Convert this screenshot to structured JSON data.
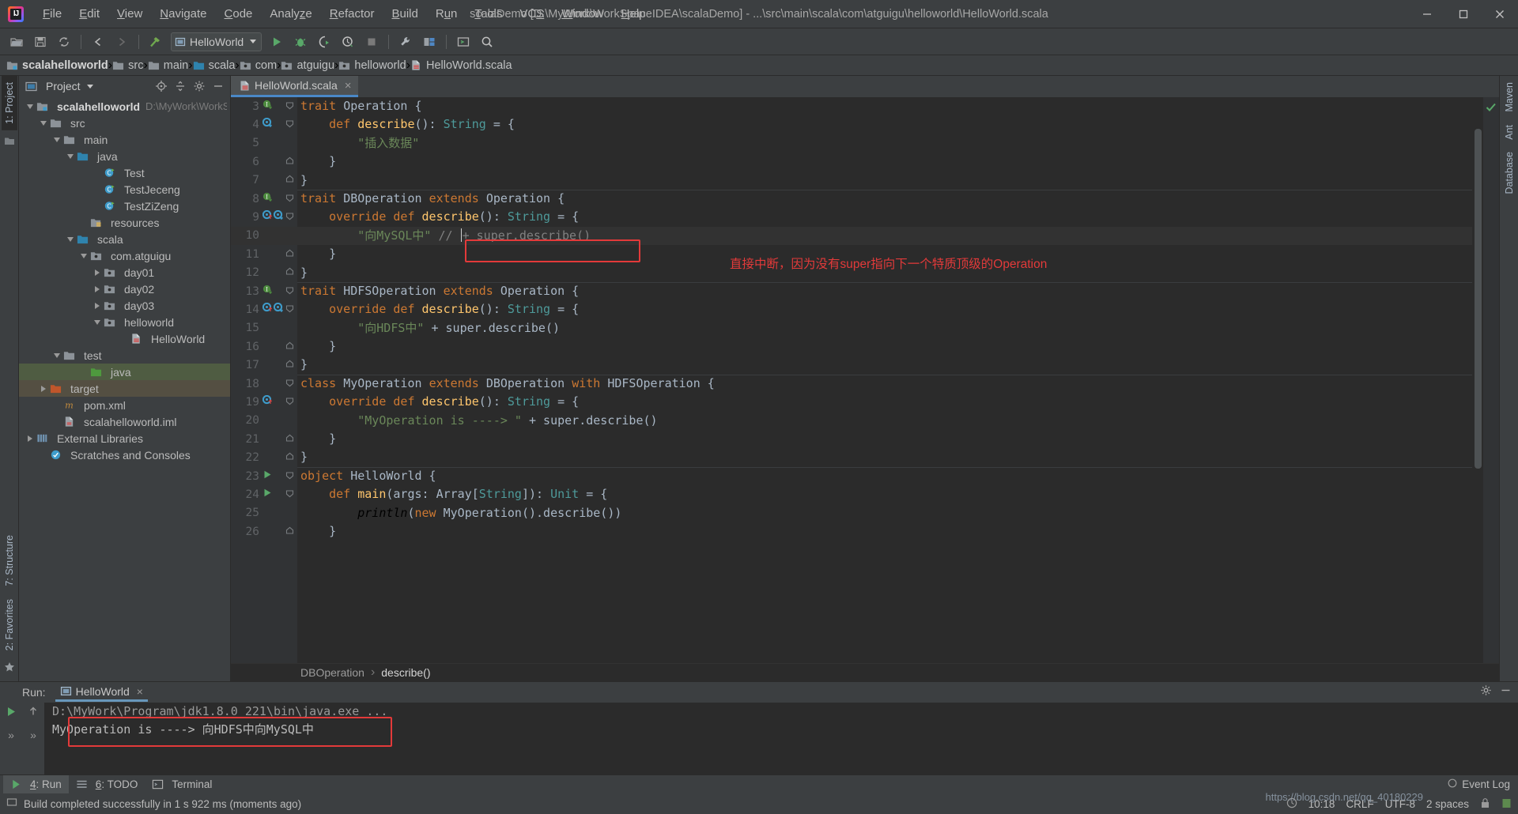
{
  "window": {
    "title": "scalaDemo [D:\\MyWork\\WorkSpaceIDEA\\scalaDemo] - ...\\src\\main\\scala\\com\\atguigu\\helloworld\\HelloWorld.scala",
    "minimize_label": "minimize-window",
    "maximize_label": "maximize-window",
    "close_label": "close-window"
  },
  "menubar": {
    "items": [
      {
        "label": "File",
        "mnemonic": "F"
      },
      {
        "label": "Edit",
        "mnemonic": "E"
      },
      {
        "label": "View",
        "mnemonic": "V"
      },
      {
        "label": "Navigate",
        "mnemonic": "N"
      },
      {
        "label": "Code",
        "mnemonic": "C"
      },
      {
        "label": "Analyze",
        "mnemonic": "z"
      },
      {
        "label": "Refactor",
        "mnemonic": "R"
      },
      {
        "label": "Build",
        "mnemonic": "B"
      },
      {
        "label": "Run",
        "mnemonic": "u"
      },
      {
        "label": "Tools",
        "mnemonic": "T"
      },
      {
        "label": "VCS",
        "mnemonic": "S"
      },
      {
        "label": "Window",
        "mnemonic": "W"
      },
      {
        "label": "Help",
        "mnemonic": "H"
      }
    ]
  },
  "toolbar": {
    "run_config": "HelloWorld",
    "buttons": [
      "open-folder-icon",
      "save-all-icon",
      "sync-icon",
      "back-arrow-icon",
      "forward-arrow-icon",
      "build-hammer-icon",
      "run-icon",
      "debug-icon",
      "run-with-coverage-icon",
      "profile-icon",
      "stop-icon",
      "settings-wrench-icon",
      "project-structure-icon",
      "terminal-icon",
      "search-everywhere-icon"
    ]
  },
  "breadcrumb": {
    "items": [
      {
        "label": "scalahelloworld",
        "icon": "module-folder-icon"
      },
      {
        "label": "src",
        "icon": "folder-icon"
      },
      {
        "label": "main",
        "icon": "folder-icon"
      },
      {
        "label": "scala",
        "icon": "source-folder-icon"
      },
      {
        "label": "com",
        "icon": "package-icon"
      },
      {
        "label": "atguigu",
        "icon": "package-icon"
      },
      {
        "label": "helloworld",
        "icon": "package-icon"
      },
      {
        "label": "HelloWorld.scala",
        "icon": "scala-file-icon"
      }
    ]
  },
  "left_rail": {
    "tabs": [
      {
        "label": "1: Project",
        "active": true
      }
    ],
    "bottom_tabs": [
      {
        "label": "7: Structure"
      },
      {
        "label": "2: Favorites"
      }
    ]
  },
  "right_rail": {
    "tabs": [
      {
        "label": "Maven"
      },
      {
        "label": "Ant"
      },
      {
        "label": "Database"
      }
    ]
  },
  "project_panel": {
    "title": "Project",
    "locate_icon": "locate-target-icon",
    "collapse_icon": "collapse-all-icon",
    "settings_icon": "gear-icon",
    "hide_icon": "hide-panel-icon",
    "tree": [
      {
        "label": "scalahelloworld",
        "path": "D:\\MyWork\\WorkSpac",
        "indent": 0,
        "twisty": "down",
        "icon": "module-folder-icon",
        "bold": true
      },
      {
        "label": "src",
        "indent": 1,
        "twisty": "down",
        "icon": "folder-icon"
      },
      {
        "label": "main",
        "indent": 2,
        "twisty": "down",
        "icon": "folder-icon"
      },
      {
        "label": "java",
        "indent": 3,
        "twisty": "down",
        "icon": "source-folder-icon"
      },
      {
        "label": "Test",
        "indent": 5,
        "twisty": "none",
        "icon": "scala-class-icon"
      },
      {
        "label": "TestJeceng",
        "indent": 5,
        "twisty": "none",
        "icon": "scala-class-icon"
      },
      {
        "label": "TestZiZeng",
        "indent": 5,
        "twisty": "none",
        "icon": "scala-class-icon"
      },
      {
        "label": "resources",
        "indent": 4,
        "twisty": "none",
        "icon": "resources-folder-icon"
      },
      {
        "label": "scala",
        "indent": 3,
        "twisty": "down",
        "icon": "source-folder-icon"
      },
      {
        "label": "com.atguigu",
        "indent": 4,
        "twisty": "down",
        "icon": "package-icon"
      },
      {
        "label": "day01",
        "indent": 5,
        "twisty": "right",
        "icon": "package-icon"
      },
      {
        "label": "day02",
        "indent": 5,
        "twisty": "right",
        "icon": "package-icon"
      },
      {
        "label": "day03",
        "indent": 5,
        "twisty": "right",
        "icon": "package-icon"
      },
      {
        "label": "helloworld",
        "indent": 5,
        "twisty": "down",
        "icon": "package-icon"
      },
      {
        "label": "HelloWorld",
        "indent": 7,
        "twisty": "none",
        "icon": "scala-file-icon"
      },
      {
        "label": "test",
        "indent": 2,
        "twisty": "down",
        "icon": "folder-icon"
      },
      {
        "label": "java",
        "indent": 4,
        "twisty": "none",
        "icon": "test-source-folder-icon",
        "selected": "green"
      },
      {
        "label": "target",
        "indent": 1,
        "twisty": "right",
        "icon": "excluded-folder-icon",
        "selected": "brown"
      },
      {
        "label": "pom.xml",
        "indent": 2,
        "twisty": "none",
        "icon": "maven-icon"
      },
      {
        "label": "scalahelloworld.iml",
        "indent": 2,
        "twisty": "none",
        "icon": "iml-file-icon"
      },
      {
        "label": "External Libraries",
        "indent": 0,
        "twisty": "right",
        "icon": "libraries-icon"
      },
      {
        "label": "Scratches and Consoles",
        "indent": 1,
        "twisty": "none",
        "icon": "scratches-icon"
      }
    ]
  },
  "editor": {
    "tab": {
      "label": "HelloWorld.scala",
      "icon": "scala-file-icon",
      "close": "×"
    },
    "first_line_number": 3,
    "lines": [
      {
        "n": 3,
        "gutter": [
          "impl-green-icon"
        ],
        "fold": "open",
        "tokens": [
          {
            "t": "trait ",
            "c": "kw"
          },
          {
            "t": "Operation",
            "c": "pln"
          },
          {
            "t": " {",
            "c": "pln"
          }
        ]
      },
      {
        "n": 4,
        "gutter": [
          "override-blue-icon"
        ],
        "fold": "open",
        "indent": 1,
        "tokens": [
          {
            "t": "def ",
            "c": "kw"
          },
          {
            "t": "describe",
            "c": "fn"
          },
          {
            "t": "(): ",
            "c": "pln"
          },
          {
            "t": "String",
            "c": "typ"
          },
          {
            "t": " = {",
            "c": "pln"
          }
        ]
      },
      {
        "n": 5,
        "indent": 2,
        "tokens": [
          {
            "t": "\"插入数据\"",
            "c": "str"
          }
        ]
      },
      {
        "n": 6,
        "fold": "close",
        "indent": 1,
        "tokens": [
          {
            "t": "}",
            "c": "pln"
          }
        ]
      },
      {
        "n": 7,
        "fold": "close",
        "tokens": [
          {
            "t": "}",
            "c": "pln"
          }
        ]
      },
      {
        "n": 8,
        "gutter": [
          "impl-green-icon"
        ],
        "fold": "open",
        "tokens": [
          {
            "t": "trait ",
            "c": "kw"
          },
          {
            "t": "DBOperation ",
            "c": "pln"
          },
          {
            "t": "extends ",
            "c": "kw"
          },
          {
            "t": "Operation",
            "c": "pln"
          },
          {
            "t": " {",
            "c": "pln"
          }
        ]
      },
      {
        "n": 9,
        "gutter": [
          "overridden-up-icon",
          "override-blue-icon"
        ],
        "fold": "open",
        "indent": 1,
        "tokens": [
          {
            "t": "override ",
            "c": "kw"
          },
          {
            "t": "def ",
            "c": "kw"
          },
          {
            "t": "describe",
            "c": "fn"
          },
          {
            "t": "(): ",
            "c": "pln"
          },
          {
            "t": "String",
            "c": "typ"
          },
          {
            "t": " = {",
            "c": "pln"
          }
        ]
      },
      {
        "n": 10,
        "indent": 2,
        "highlight": true,
        "tokens": [
          {
            "t": "\"向MySQL中\"",
            "c": "str"
          },
          {
            "t": " ",
            "c": "pln"
          },
          {
            "t": "// ",
            "c": "cmt"
          },
          {
            "t": "+ super.describe()",
            "c": "cmt"
          }
        ]
      },
      {
        "n": 11,
        "fold": "close",
        "indent": 1,
        "tokens": [
          {
            "t": "}",
            "c": "pln"
          }
        ]
      },
      {
        "n": 12,
        "fold": "close",
        "tokens": [
          {
            "t": "}",
            "c": "pln"
          }
        ]
      },
      {
        "n": 13,
        "gutter": [
          "impl-green-icon"
        ],
        "fold": "open",
        "tokens": [
          {
            "t": "trait ",
            "c": "kw"
          },
          {
            "t": "HDFSOperation ",
            "c": "pln"
          },
          {
            "t": "extends ",
            "c": "kw"
          },
          {
            "t": "Operation",
            "c": "pln"
          },
          {
            "t": " {",
            "c": "pln"
          }
        ]
      },
      {
        "n": 14,
        "gutter": [
          "overridden-up-icon",
          "override-blue-icon"
        ],
        "fold": "open",
        "indent": 1,
        "tokens": [
          {
            "t": "override ",
            "c": "kw"
          },
          {
            "t": "def ",
            "c": "kw"
          },
          {
            "t": "describe",
            "c": "fn"
          },
          {
            "t": "(): ",
            "c": "pln"
          },
          {
            "t": "String",
            "c": "typ"
          },
          {
            "t": " = {",
            "c": "pln"
          }
        ]
      },
      {
        "n": 15,
        "indent": 2,
        "tokens": [
          {
            "t": "\"向HDFS中\"",
            "c": "str"
          },
          {
            "t": " + super.describe()",
            "c": "pln"
          }
        ]
      },
      {
        "n": 16,
        "fold": "close",
        "indent": 1,
        "tokens": [
          {
            "t": "}",
            "c": "pln"
          }
        ]
      },
      {
        "n": 17,
        "fold": "close",
        "tokens": [
          {
            "t": "}",
            "c": "pln"
          }
        ]
      },
      {
        "n": 18,
        "fold": "open",
        "tokens": [
          {
            "t": "class ",
            "c": "kw"
          },
          {
            "t": "MyOperation ",
            "c": "pln"
          },
          {
            "t": "extends ",
            "c": "kw"
          },
          {
            "t": "DBOperation ",
            "c": "pln"
          },
          {
            "t": "with ",
            "c": "kw"
          },
          {
            "t": "HDFSOperation",
            "c": "pln"
          },
          {
            "t": " {",
            "c": "pln"
          }
        ]
      },
      {
        "n": 19,
        "gutter": [
          "overridden-up-icon"
        ],
        "fold": "open",
        "indent": 1,
        "tokens": [
          {
            "t": "override ",
            "c": "kw"
          },
          {
            "t": "def ",
            "c": "kw"
          },
          {
            "t": "describe",
            "c": "fn"
          },
          {
            "t": "(): ",
            "c": "pln"
          },
          {
            "t": "String",
            "c": "typ"
          },
          {
            "t": " = {",
            "c": "pln"
          }
        ]
      },
      {
        "n": 20,
        "indent": 2,
        "tokens": [
          {
            "t": "\"MyOperation is ----> \"",
            "c": "str"
          },
          {
            "t": " + super.describe()",
            "c": "pln"
          }
        ]
      },
      {
        "n": 21,
        "fold": "close",
        "indent": 1,
        "tokens": [
          {
            "t": "}",
            "c": "pln"
          }
        ]
      },
      {
        "n": 22,
        "fold": "close",
        "tokens": [
          {
            "t": "}",
            "c": "pln"
          }
        ]
      },
      {
        "n": 23,
        "gutter": [
          "run-gutter-icon"
        ],
        "fold": "open",
        "tokens": [
          {
            "t": "object ",
            "c": "kw"
          },
          {
            "t": "HelloWorld",
            "c": "pln"
          },
          {
            "t": " {",
            "c": "pln"
          }
        ]
      },
      {
        "n": 24,
        "gutter": [
          "run-gutter-icon"
        ],
        "fold": "open",
        "indent": 1,
        "tokens": [
          {
            "t": "def ",
            "c": "kw"
          },
          {
            "t": "main",
            "c": "fn"
          },
          {
            "t": "(args: Array[",
            "c": "pln"
          },
          {
            "t": "String",
            "c": "typ"
          },
          {
            "t": "]): ",
            "c": "pln"
          },
          {
            "t": "Unit",
            "c": "typ"
          },
          {
            "t": " = {",
            "c": "pln"
          }
        ]
      },
      {
        "n": 25,
        "indent": 2,
        "tokens": [
          {
            "t": "println",
            "c": "ital"
          },
          {
            "t": "(",
            "c": "pln"
          },
          {
            "t": "new ",
            "c": "kw"
          },
          {
            "t": "MyOperation().describe())",
            "c": "pln"
          }
        ]
      },
      {
        "n": 26,
        "fold": "close",
        "indent": 1,
        "tokens": [
          {
            "t": "}",
            "c": "pln"
          }
        ]
      }
    ],
    "annotation": "直接中断，因为没有super指向下一个特质顶级的Operation",
    "annotation_color": "#e33a3a",
    "breadcrumb": [
      {
        "label": "DBOperation",
        "current": false
      },
      {
        "label": "describe()",
        "current": true
      }
    ]
  },
  "run_panel": {
    "label": "Run:",
    "tab": {
      "label": "HelloWorld",
      "icon": "run-config-icon",
      "close": "×"
    },
    "settings_icon": "gear-icon",
    "hide_icon": "hide-panel-icon",
    "side_buttons": [
      "rerun-icon",
      "scroll-up-icon",
      "expand-icon",
      "expand-icon-2"
    ],
    "console_lines": [
      {
        "text": "D:\\MyWork\\Program\\jdk1.8.0_221\\bin\\java.exe ...",
        "style": "cmd"
      },
      {
        "text": "MyOperation is ----> 向HDFS中向MySQL中",
        "style": "out",
        "boxed": true
      }
    ]
  },
  "bottom_tabs": {
    "items": [
      {
        "label": "4: Run",
        "mnemonic": "4",
        "icon": "run-icon",
        "active": true
      },
      {
        "label": "6: TODO",
        "mnemonic": "6",
        "icon": "todo-icon",
        "active": false
      },
      {
        "label": "Terminal",
        "icon": "terminal-icon",
        "active": false
      }
    ],
    "event_log": "Event Log"
  },
  "status_bar": {
    "message": "Build completed successfully in 1 s 922 ms (moments ago)",
    "time": "10:18",
    "line_ending": "CRLF",
    "encoding": "UTF-8",
    "indent": "2 spaces",
    "watermark": "https://blog.csdn.net/qq_40180229"
  }
}
